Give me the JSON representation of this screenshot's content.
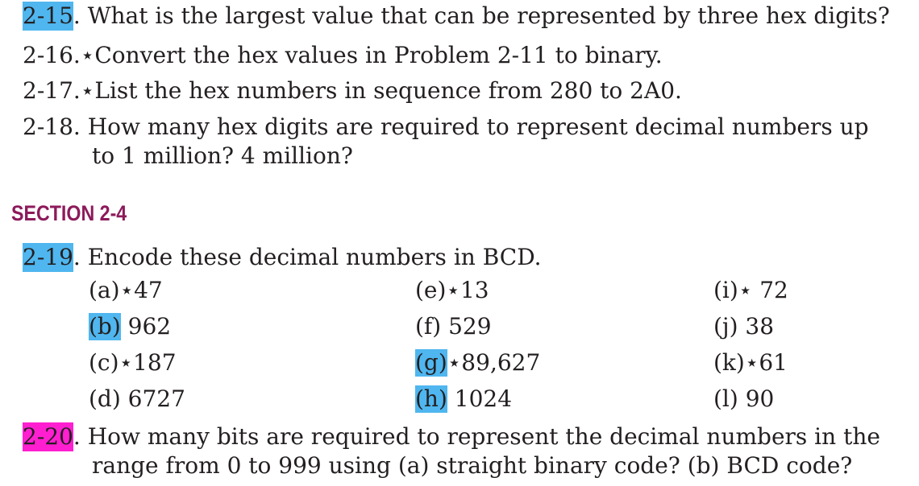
{
  "problems": [
    {
      "number": "2-15",
      "separator": ". ",
      "text": "What is the largest value that can be represented by three hex digits?",
      "highlight": "#4fb6ef"
    },
    {
      "number": "2-16",
      "separator": ".*",
      "text": "Convert the hex values in Problem 2-11 to binary."
    },
    {
      "number": "2-17",
      "separator": ".*",
      "text": "List the hex numbers in sequence from 280 to 2A0."
    },
    {
      "number": "2-18",
      "separator": ". ",
      "text": "How many hex digits are required to represent decimal numbers up",
      "continuation": "to 1 million? 4 million?"
    }
  ],
  "section": {
    "title": "SECTION 2-4",
    "color": "#8d1a5b"
  },
  "problem_219": {
    "number": "2-19",
    "separator": ". ",
    "text": "Encode these decimal numbers in BCD.",
    "highlight": "#4fb6ef"
  },
  "parts": {
    "col1": [
      {
        "label": "(a)",
        "value": "*47"
      },
      {
        "label": "(b)",
        "value": " 962",
        "highlight": "#4fb6ef"
      },
      {
        "label": "(c)",
        "value": "*187"
      },
      {
        "label": "(d)",
        "value": " 6727"
      }
    ],
    "col2": [
      {
        "label": "(e)",
        "value": "*13"
      },
      {
        "label": "(f)",
        "value": " 529"
      },
      {
        "label": "(g)",
        "value": "*89,627",
        "highlight": "#4fb6ef"
      },
      {
        "label": "(h)",
        "value": " 1024",
        "highlight": "#4fb6ef"
      }
    ],
    "col3": [
      {
        "label": "(i)",
        "value": "* 72"
      },
      {
        "label": "(j)",
        "value": " 38"
      },
      {
        "label": "(k)",
        "value": "*61"
      },
      {
        "label": "(l)",
        "value": " 90"
      }
    ]
  },
  "problem_220": {
    "number": "2-20",
    "separator": ". ",
    "text": "How many bits are required to represent the decimal numbers in the",
    "continuation": "range from 0 to 999 using (a) straight binary code? (b) BCD code?",
    "highlight": "#ff1fd0"
  }
}
